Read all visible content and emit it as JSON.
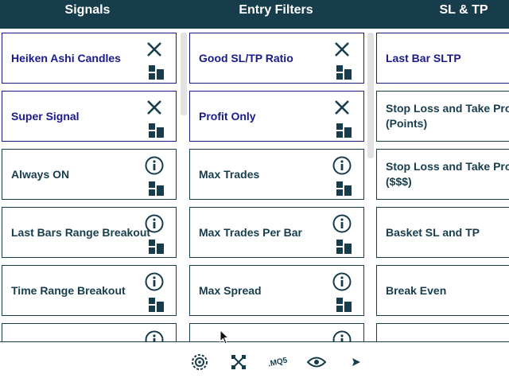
{
  "header": {
    "columns": [
      "Signals",
      "Entry Filters",
      "SL & TP"
    ]
  },
  "signals": [
    {
      "label": "Heiken Ashi Candles",
      "action_icon": "close-icon",
      "selected": true
    },
    {
      "label": "Super Signal",
      "action_icon": "close-icon",
      "selected": true
    },
    {
      "label": "Always ON",
      "action_icon": "info-icon",
      "selected": false
    },
    {
      "label": "Last Bars Range Breakout",
      "action_icon": "info-icon",
      "selected": false
    },
    {
      "label": "Time Range Breakout",
      "action_icon": "info-icon",
      "selected": false
    },
    {
      "label": "",
      "action_icon": "info-icon",
      "selected": false
    }
  ],
  "filters": [
    {
      "label": "Good SL/TP Ratio",
      "action_icon": "close-icon",
      "selected": true
    },
    {
      "label": "Profit Only",
      "action_icon": "close-icon",
      "selected": true
    },
    {
      "label": "Max Trades",
      "action_icon": "info-icon",
      "selected": false
    },
    {
      "label": "Max Trades Per Bar",
      "action_icon": "info-icon",
      "selected": false
    },
    {
      "label": "Max Spread",
      "action_icon": "info-icon",
      "selected": false
    },
    {
      "label": "",
      "action_icon": "info-icon",
      "selected": false
    }
  ],
  "sltp": [
    {
      "label": "Last Bar SLTP",
      "selected": true
    },
    {
      "label": "Stop Loss and Take Profit\n(Points)",
      "selected": false
    },
    {
      "label": "Stop Loss and Take Profit\n($$$)",
      "selected": false
    },
    {
      "label": "Basket SL and TP",
      "selected": false
    },
    {
      "label": "Break Even",
      "selected": false
    },
    {
      "label": "",
      "selected": false
    }
  ],
  "toolbar": {
    "tools": [
      "settings-gear-icon",
      "arrange-icon",
      "mq5-export-icon",
      "eye-icon",
      "arrow-right-icon"
    ],
    "mq5_label": ".MQ5"
  },
  "colors": {
    "primary": "#173d4d",
    "selected_text": "#1a1a8c",
    "background": "#ffffff",
    "scrollbar": "#e2e2e2"
  }
}
